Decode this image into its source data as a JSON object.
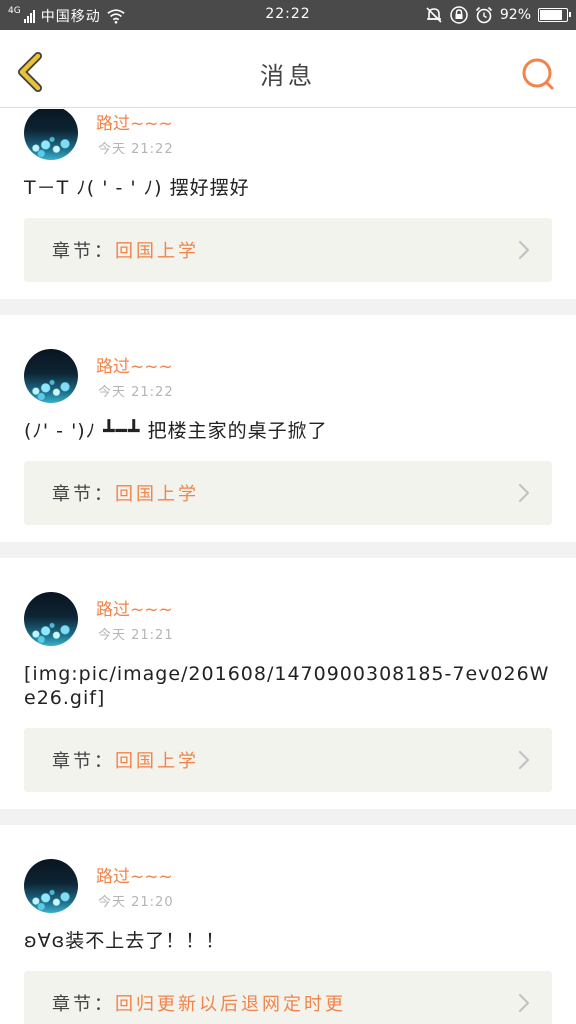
{
  "status_bar": {
    "network": "4G",
    "carrier": "中国移动",
    "time": "22:22",
    "battery_text": "92%",
    "battery_level": 0.92,
    "icons": [
      "signal-icon",
      "wifi-icon",
      "mute-icon",
      "lock-icon",
      "alarm-icon",
      "battery-icon"
    ]
  },
  "nav": {
    "title": "消息",
    "back_icon": "chevron-left-icon",
    "search_icon": "search-icon",
    "accent_color": "#f0844a",
    "back_color": "#e9c235"
  },
  "messages": [
    {
      "username": "路过~~~",
      "time": "今天 21:22",
      "content": "T－T ﾉ( ' - ' ﾉ) 摆好摆好",
      "chapter_label": "章节：",
      "chapter_title": "回国上学"
    },
    {
      "username": "路过~~~",
      "time": "今天 21:22",
      "content": "(ﾉ' - ')ﾉ ┻━┻ 把楼主家的桌子掀了",
      "chapter_label": "章节：",
      "chapter_title": "回国上学"
    },
    {
      "username": "路过~~~",
      "time": "今天 21:21",
      "content": "[img:pic/image/201608/1470900308185-7ev026We26.gif]",
      "chapter_label": "章节：",
      "chapter_title": "回国上学"
    },
    {
      "username": "路过~~~",
      "time": "今天 21:20",
      "content": "ʚ∀ɞ装不上去了！！！",
      "chapter_label": "章节：",
      "chapter_title": "回归更新以后退网定时更"
    }
  ]
}
